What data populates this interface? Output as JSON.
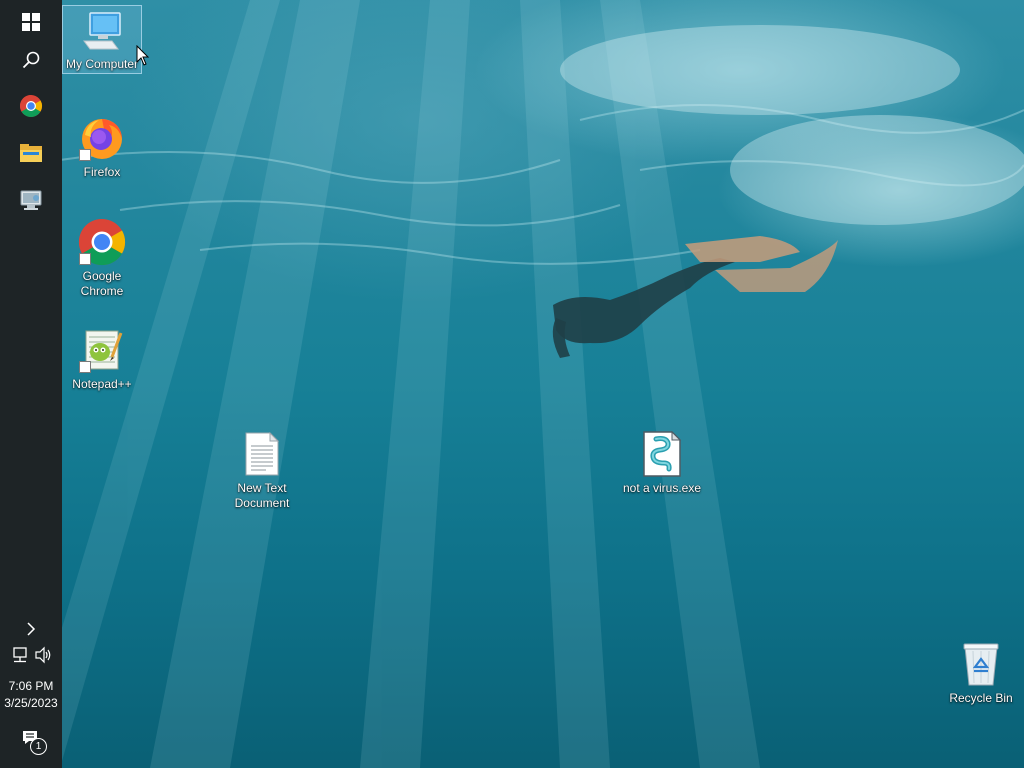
{
  "taskbar": {
    "pinned": [
      {
        "name": "start"
      },
      {
        "name": "search"
      },
      {
        "name": "google-chrome"
      },
      {
        "name": "file-explorer"
      },
      {
        "name": "control-panel"
      }
    ],
    "tray": {
      "time": "7:06 PM",
      "date": "3/25/2023",
      "notification_count": "1"
    }
  },
  "desktop": {
    "icons": [
      {
        "label": "My Computer",
        "icon": "computer-icon",
        "selected": true
      },
      {
        "label": "Firefox",
        "icon": "firefox-icon",
        "shortcut": true
      },
      {
        "label": "Google Chrome",
        "icon": "chrome-icon",
        "shortcut": true
      },
      {
        "label": "Notepad++",
        "icon": "notepad-plus-plus-icon",
        "shortcut": true
      },
      {
        "label": "New Text Document",
        "icon": "text-file-icon"
      },
      {
        "label": "not a virus.exe",
        "icon": "script-file-icon"
      },
      {
        "label": "Recycle Bin",
        "icon": "recycle-bin-icon"
      }
    ]
  },
  "colors": {
    "taskbar": "#1e2426",
    "wallpaper_mid": "#178097",
    "selection": "#78bedc"
  }
}
